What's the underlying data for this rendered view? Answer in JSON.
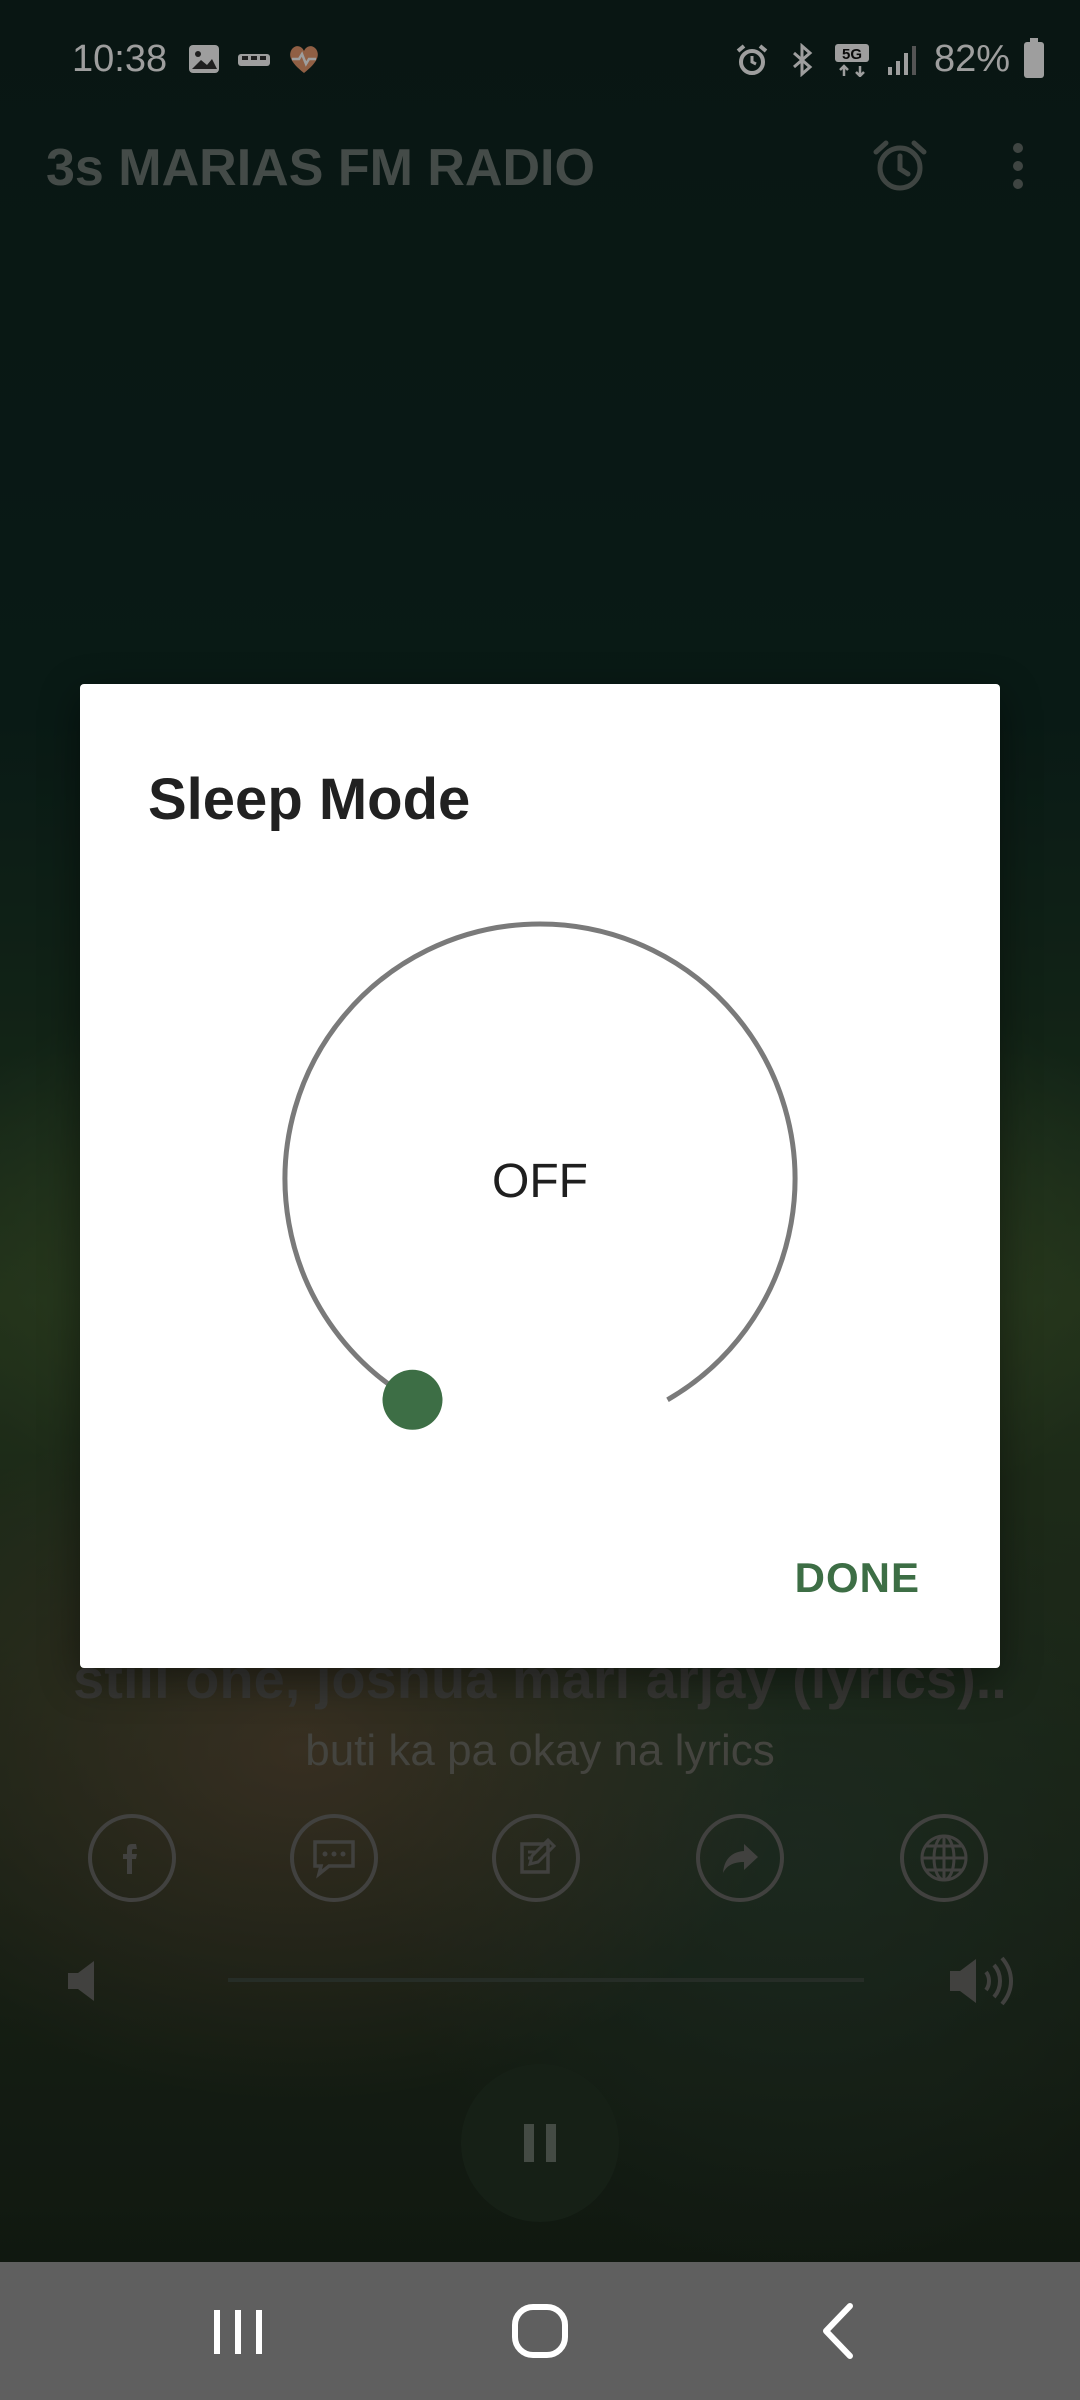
{
  "status_bar": {
    "time": "10:38",
    "battery": "82%",
    "network": "5G",
    "icons": [
      "gallery-icon",
      "cloud-icon",
      "health-icon",
      "alarm-icon",
      "bluetooth-icon",
      "5g-icon",
      "signal-icon",
      "battery-icon"
    ]
  },
  "app_bar": {
    "title": "3s MARIAS FM RADIO",
    "icons": [
      "alarm-clock-icon",
      "more-vert-icon"
    ]
  },
  "now_playing": {
    "title": "still one, joshua mari  arjay (lyrics)..",
    "subtitle": "buti ka pa okay na lyrics",
    "actions": [
      "facebook-icon",
      "chat-icon",
      "edit-icon",
      "share-icon",
      "globe-icon"
    ],
    "volume_icons": [
      "volume-low-icon",
      "volume-high-icon"
    ],
    "state": "playing"
  },
  "dialog": {
    "title": "Sleep Mode",
    "value_label": "OFF",
    "dial_level": 0,
    "done_label": "DONE",
    "accent_color": "#3d6e45"
  },
  "nav_bar": {
    "buttons": [
      "recents-icon",
      "home-icon",
      "back-icon"
    ]
  }
}
